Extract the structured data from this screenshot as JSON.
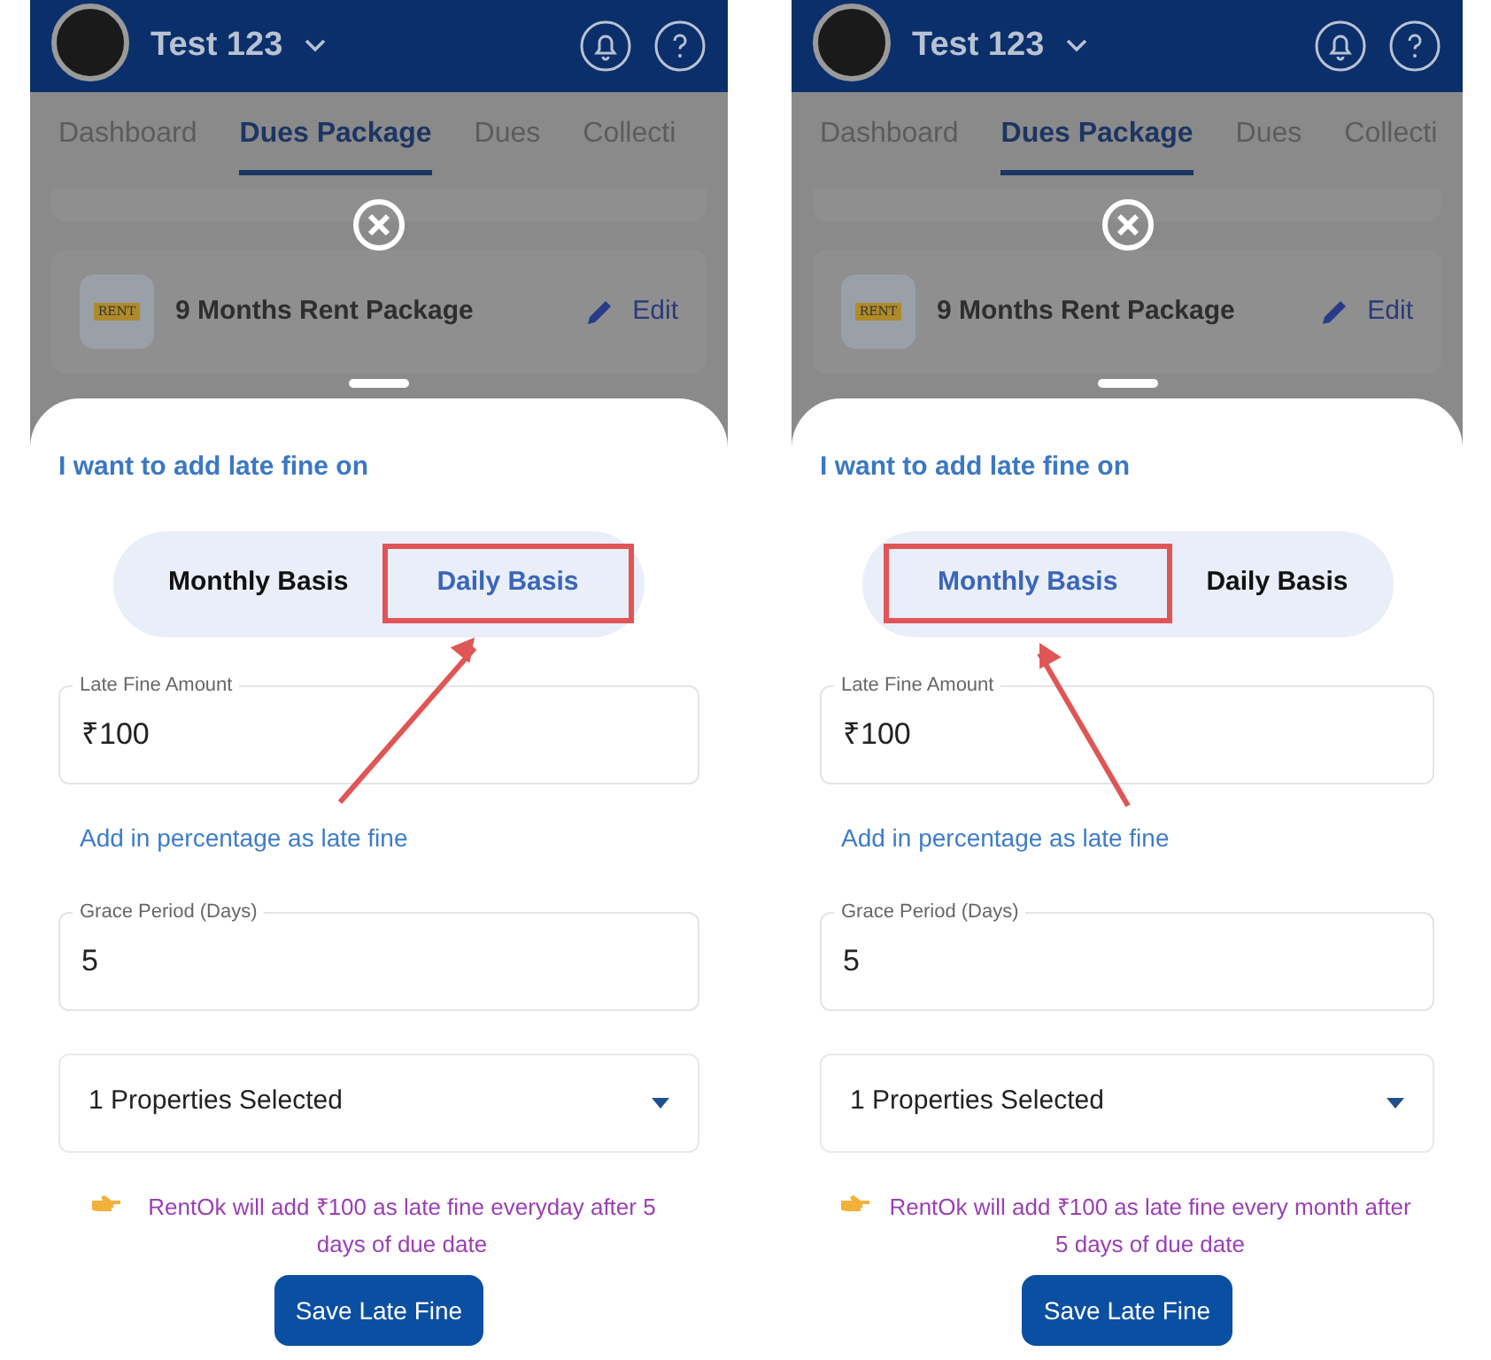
{
  "screens": [
    {
      "header": {
        "title": "Test 123"
      },
      "tabs": [
        {
          "label": "Dashboard",
          "selected": false
        },
        {
          "label": "Dues Package",
          "selected": true
        },
        {
          "label": "Dues",
          "selected": false
        },
        {
          "label": "Collecti",
          "selected": false
        }
      ],
      "package_card": {
        "name": "9 Months Rent Package",
        "icon_label": "RENT",
        "action": "Edit"
      },
      "sheet": {
        "title": "I want to add late fine on",
        "options": [
          {
            "label": "Monthly Basis",
            "selected": false
          },
          {
            "label": "Daily Basis",
            "selected": true
          }
        ],
        "late_fine_field": {
          "label": "Late Fine Amount",
          "value": "₹100"
        },
        "percentage_link": "Add in percentage as late fine",
        "grace_field": {
          "label": "Grace Period (Days)",
          "value": "5"
        },
        "properties_dropdown": {
          "value": "1 Properties Selected"
        },
        "note": "RentOk will add ₹100 as late fine everyday after 5 days of due date",
        "save_button": "Save Late Fine"
      }
    },
    {
      "header": {
        "title": "Test 123"
      },
      "tabs": [
        {
          "label": "Dashboard",
          "selected": false
        },
        {
          "label": "Dues Package",
          "selected": true
        },
        {
          "label": "Dues",
          "selected": false
        },
        {
          "label": "Collecti",
          "selected": false
        }
      ],
      "package_card": {
        "name": "9 Months Rent Package",
        "icon_label": "RENT",
        "action": "Edit"
      },
      "sheet": {
        "title": "I want to add late fine on",
        "options": [
          {
            "label": "Monthly Basis",
            "selected": true
          },
          {
            "label": "Daily Basis",
            "selected": false
          }
        ],
        "late_fine_field": {
          "label": "Late Fine Amount",
          "value": "₹100"
        },
        "percentage_link": "Add in percentage as late fine",
        "grace_field": {
          "label": "Grace Period (Days)",
          "value": "5"
        },
        "properties_dropdown": {
          "value": "1 Properties Selected"
        },
        "note": "RentOk will add ₹100 as late fine every month after 5 days of due date",
        "save_button": "Save Late Fine"
      }
    }
  ]
}
